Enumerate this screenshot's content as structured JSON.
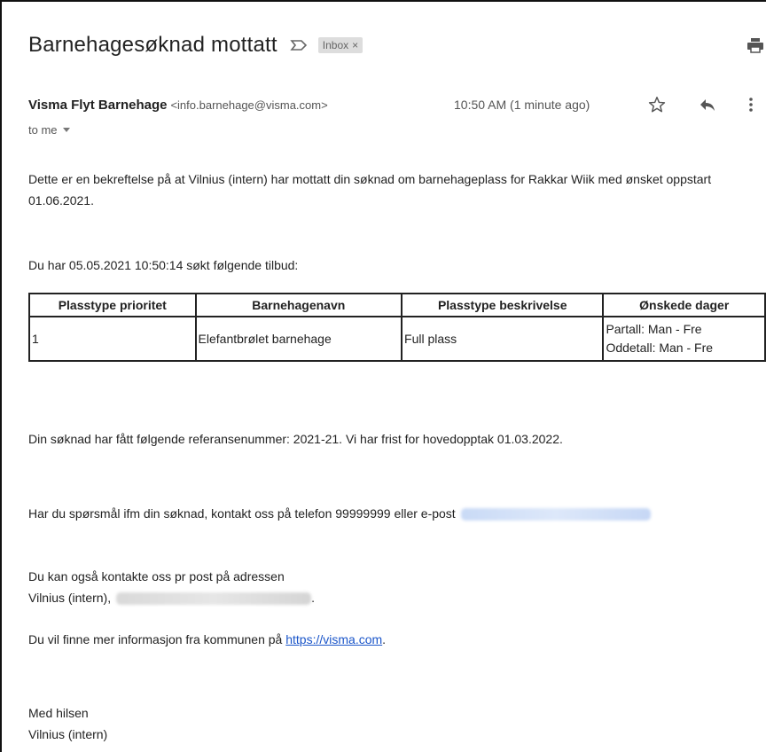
{
  "email": {
    "subject": "Barnehagesøknad mottatt",
    "label": "Inbox",
    "label_remove": "×",
    "sender_name": "Visma Flyt Barnehage",
    "sender_email": "<info.barnehage@visma.com>",
    "timestamp": "10:50 AM (1 minute ago)",
    "recipient": "to me"
  },
  "body": {
    "p1": "Dette er en bekreftelse på at Vilnius (intern) har mottatt din søknad om barnehageplass for Rakkar Wiik med ønsket oppstart 01.06.2021.",
    "p2": "Du har 05.05.2021 10:50:14 søkt følgende tilbud:",
    "table": {
      "headers": [
        "Plasstype prioritet",
        "Barnehagenavn",
        "Plasstype beskrivelse",
        "Ønskede dager"
      ],
      "row": {
        "priority": "1",
        "kindergarten": "Elefantbrølet barnehage",
        "description": "Full plass",
        "days_even": "Partall: Man - Fre",
        "days_odd": "Oddetall: Man - Fre"
      }
    },
    "p3": "Din søknad har fått følgende referansenummer: 2021-21. Vi har frist for hovedopptak 01.03.2022.",
    "p4": "Har du spørsmål ifm din søknad, kontakt oss på telefon 99999999 eller e-post",
    "p5_line1": "Du kan også kontakte oss pr post på adressen",
    "p5_line2": "Vilnius (intern),",
    "p5_end": ".",
    "p6_prefix": "Du vil finne mer informasjon fra kommunen på",
    "p6_link": "https://visma.com",
    "p6_suffix": ".",
    "closing": "Med hilsen",
    "signature": "Vilnius (intern)"
  },
  "icons": {
    "important": "label-important-icon",
    "print": "print-icon",
    "star": "star-icon",
    "reply": "reply-icon",
    "more": "more-vert-icon",
    "dropdown": "chevron-down-icon"
  }
}
